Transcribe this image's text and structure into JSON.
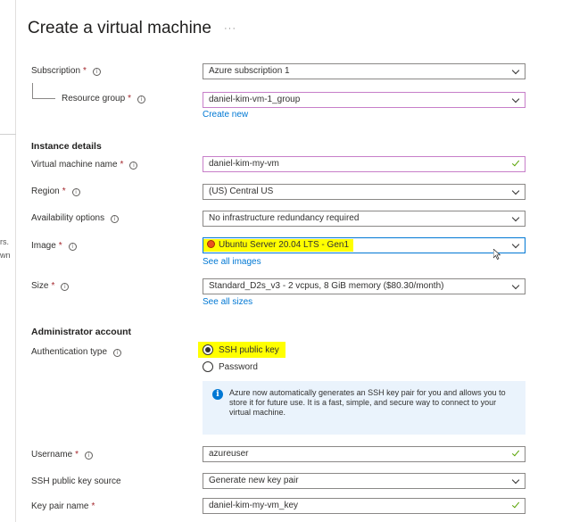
{
  "title": "Create a virtual machine",
  "title_ellipsis": "···",
  "left_cut": [
    "rs.",
    "wn"
  ],
  "project": {
    "subscription_label": "Subscription",
    "subscription_value": "Azure subscription 1",
    "resource_group_label": "Resource group",
    "resource_group_value": "daniel-kim-vm-1_group",
    "create_new": "Create new"
  },
  "instance": {
    "header": "Instance details",
    "vm_name_label": "Virtual machine name",
    "vm_name_value": "daniel-kim-my-vm",
    "region_label": "Region",
    "region_value": "(US) Central US",
    "availability_label": "Availability options",
    "availability_value": "No infrastructure redundancy required",
    "image_label": "Image",
    "image_value": "Ubuntu Server 20.04 LTS - Gen1",
    "see_all_images": "See all images",
    "size_label": "Size",
    "size_value": "Standard_D2s_v3 - 2 vcpus, 8 GiB memory ($80.30/month)",
    "see_all_sizes": "See all sizes"
  },
  "admin": {
    "header": "Administrator account",
    "auth_label": "Authentication type",
    "auth_options": [
      "SSH public key",
      "Password"
    ],
    "auth_selected": "SSH public key",
    "info_text": "Azure now automatically generates an SSH key pair for you and allows you to store it for future use. It is a fast, simple, and secure way to connect to your virtual machine.",
    "username_label": "Username",
    "username_value": "azureuser",
    "ssh_source_label": "SSH public key source",
    "ssh_source_value": "Generate new key pair",
    "key_pair_label": "Key pair name",
    "key_pair_value": "daniel-kim-my-vm_key"
  },
  "required_mark": "*",
  "info_glyph": "i",
  "colors": {
    "link": "#0078d4",
    "required": "#a4262c",
    "highlight": "#ffff00",
    "valid_check": "#57a300",
    "info_bg": "#eaf3fc",
    "ubuntu": "#e95420"
  }
}
